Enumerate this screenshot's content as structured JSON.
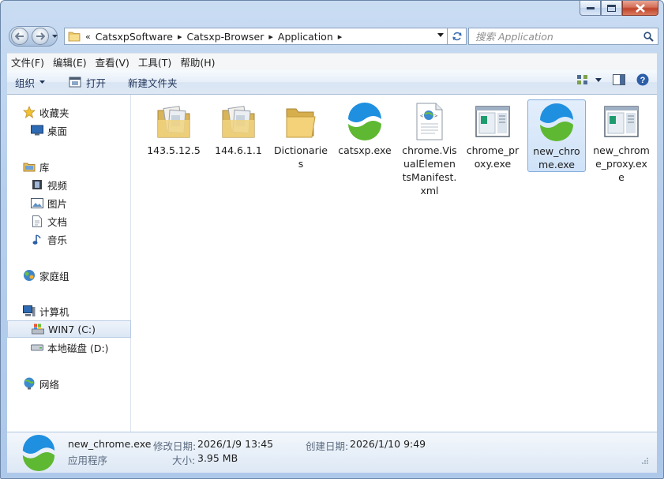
{
  "window": {
    "caption_buttons": [
      "minimize",
      "maximize",
      "close"
    ]
  },
  "nav": {
    "breadcrumb_prefix": "«",
    "breadcrumbs": [
      "CatsxpSoftware",
      "Catsxp-Browser",
      "Application"
    ],
    "search_placeholder": "搜索 Application"
  },
  "menu": [
    "文件(F)",
    "编辑(E)",
    "查看(V)",
    "工具(T)",
    "帮助(H)"
  ],
  "toolbar": {
    "organize": "组织",
    "open": "打开",
    "new_folder": "新建文件夹"
  },
  "sidebar": {
    "favorites": {
      "label": "收藏夹",
      "items": [
        "桌面"
      ]
    },
    "libraries": {
      "label": "库",
      "items": [
        "视频",
        "图片",
        "文档",
        "音乐"
      ]
    },
    "homegroup": {
      "label": "家庭组"
    },
    "computer": {
      "label": "计算机",
      "items": [
        "WIN7 (C:)",
        "本地磁盘 (D:)"
      ]
    },
    "network": {
      "label": "网络"
    }
  },
  "files": [
    {
      "name": "143.5.12.5",
      "type": "folder"
    },
    {
      "name": "144.6.1.1",
      "type": "folder"
    },
    {
      "name": "Dictionaries",
      "type": "folder-plain"
    },
    {
      "name": "catsxp.exe",
      "type": "app"
    },
    {
      "name": "chrome.VisualElementsManifest.xml",
      "type": "xml"
    },
    {
      "name": "chrome_proxy.exe",
      "type": "window-exe"
    },
    {
      "name": "new_chrome.exe",
      "type": "app",
      "selected": true
    },
    {
      "name": "new_chrome_proxy.exe",
      "type": "window-exe"
    }
  ],
  "status": {
    "filename": "new_chrome.exe",
    "type": "应用程序",
    "modified_label": "修改日期:",
    "modified_value": "2026/1/9 13:45",
    "created_label": "创建日期:",
    "created_value": "2026/1/10 9:49",
    "size_label": "大小:",
    "size_value": "3.95 MB"
  },
  "colors": {
    "accent": "#3f6fb3",
    "selection": "#cfe2f8",
    "app_blue": "#1f8fe0",
    "app_green": "#5fb832"
  }
}
